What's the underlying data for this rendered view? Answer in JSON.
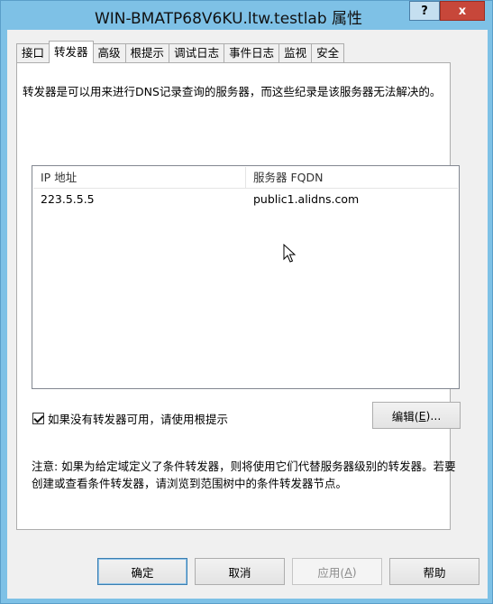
{
  "window": {
    "title": "WIN-BMATP68V6KU.ltw.testlab 属性",
    "help_label": "?",
    "close_label": "x"
  },
  "tabs": [
    {
      "label": "接口",
      "active": false
    },
    {
      "label": "转发器",
      "active": true
    },
    {
      "label": "高级",
      "active": false
    },
    {
      "label": "根提示",
      "active": false
    },
    {
      "label": "调试日志",
      "active": false
    },
    {
      "label": "事件日志",
      "active": false
    },
    {
      "label": "监视",
      "active": false
    },
    {
      "label": "安全",
      "active": false
    }
  ],
  "forwarders": {
    "description": "转发器是可以用来进行DNS记录查询的服务器，而这些纪录是该服务器无法解决的。",
    "columns": {
      "ip": "IP 地址",
      "fqdn": "服务器 FQDN"
    },
    "rows": [
      {
        "ip": "223.5.5.5",
        "fqdn": "public1.alidns.com"
      }
    ],
    "use_root_hints_label": "如果没有转发器可用，请使用根提示",
    "use_root_hints_checked": true,
    "edit_label_pre": "编辑(",
    "edit_label_key": "E",
    "edit_label_post": ")...",
    "note": "注意: 如果为给定域定义了条件转发器，则将使用它们代替服务器级别的转发器。若要创建或查看条件转发器，请浏览到范围树中的条件转发器节点。"
  },
  "buttons": {
    "ok": "确定",
    "cancel": "取消",
    "apply_pre": "应用(",
    "apply_key": "A",
    "apply_post": ")",
    "help": "帮助"
  }
}
